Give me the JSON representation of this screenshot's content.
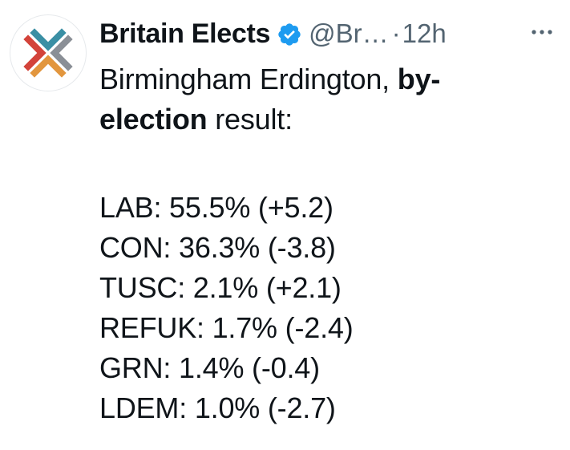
{
  "tweet": {
    "author_name": "Britain Elects",
    "handle": "@Br…",
    "separator": "·",
    "time": "12h",
    "text_plain_1": "Birmingham Erdington, ",
    "text_bold_1": "by-",
    "text_bold_2": "election",
    "text_plain_2": " result:",
    "results": [
      {
        "text": "LAB: 55.5% (+5.2)"
      },
      {
        "text": "CON: 36.3% (-3.8)"
      },
      {
        "text": "TUSC: 2.1% (+2.1)"
      },
      {
        "text": "REFUK: 1.7% (-2.4)"
      },
      {
        "text": "GRN: 1.4% (-0.4)"
      },
      {
        "text": "LDEM: 1.0% (-2.7)"
      }
    ]
  },
  "icons": {
    "avatar": "britain-elects-logo",
    "verified": "verified-badge-icon",
    "more": "more-options-icon"
  },
  "colors": {
    "verified": "#1d9bf0",
    "logo_teal": "#3a8fa4",
    "logo_red": "#d3433a",
    "logo_orange": "#e2963e",
    "secondary_text": "#536471"
  }
}
